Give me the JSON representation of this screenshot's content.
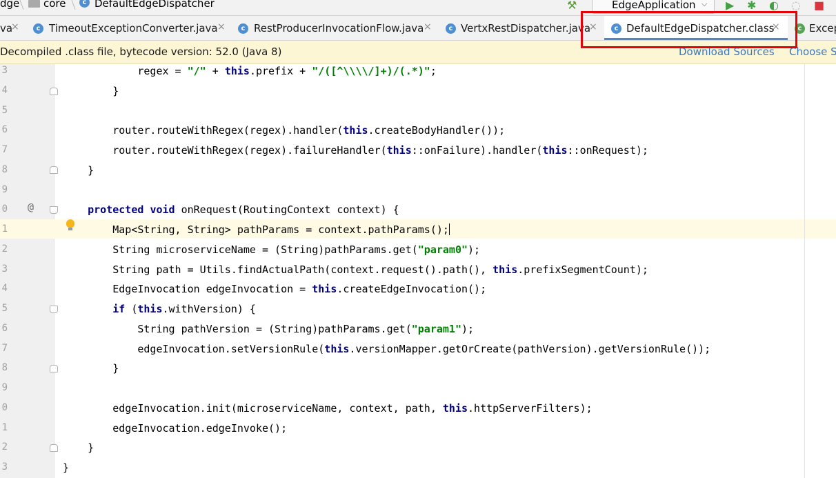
{
  "breadcrumb": {
    "items": [
      "dge",
      "core",
      "DefaultEdgeDispatcher"
    ]
  },
  "toolbar": {
    "run_config": "EdgeApplication"
  },
  "tabs": [
    {
      "label": "va"
    },
    {
      "label": "TimeoutExceptionConverter.java"
    },
    {
      "label": "RestProducerInvocationFlow.java"
    },
    {
      "label": "VertxRestDispatcher.java"
    },
    {
      "label": "DefaultEdgeDispatcher.class",
      "active": true
    },
    {
      "label": "Excep"
    }
  ],
  "tab_close_glyph": "×",
  "banner": {
    "message": "Decompiled .class file, bytecode version: 52.0 (Java 8)",
    "download_sources": "Download Sources",
    "choose_sources": "Choose S"
  },
  "gutter": {
    "line_numbers": [
      "3",
      "4",
      "5",
      "6",
      "7",
      "8",
      "9",
      "0",
      "1",
      "2",
      "3",
      "4",
      "5",
      "6",
      "7",
      "8",
      "9",
      "0",
      "1",
      "2",
      "3"
    ],
    "override_marker": "@"
  },
  "code": [
    "            regex = \"/\" + this.prefix + \"/([^\\\\\\\\/]+)/(.*)\";",
    "        }",
    "",
    "        router.routeWithRegex(regex).handler(this.createBodyHandler());",
    "        router.routeWithRegex(regex).failureHandler(this::onFailure).handler(this::onRequest);",
    "    }",
    "",
    "    protected void onRequest(RoutingContext context) {",
    "        Map<String, String> pathParams = context.pathParams();",
    "        String microserviceName = (String)pathParams.get(\"param0\");",
    "        String path = Utils.findActualPath(context.request().path(), this.prefixSegmentCount);",
    "        EdgeInvocation edgeInvocation = this.createEdgeInvocation();",
    "        if (this.withVersion) {",
    "            String pathVersion = (String)pathParams.get(\"param1\");",
    "            edgeInvocation.setVersionRule(this.versionMapper.getOrCreate(pathVersion).getVersionRule());",
    "        }",
    "",
    "        edgeInvocation.init(microserviceName, context, path, this.httpServerFilters);",
    "        edgeInvocation.edgeInvoke();",
    "    }",
    "}"
  ],
  "colors": {
    "keyword": "#000080",
    "string": "#008000",
    "highlight_box": "#e8000b",
    "current_line": "#fffae3",
    "banner_bg": "#fdf6d4",
    "link": "#3a78c2",
    "active_tab_underline": "#4a88c7"
  },
  "icons": [
    "folder-icon",
    "class-icon",
    "hammer-icon",
    "run-icon",
    "debug-icon",
    "coverage-icon",
    "profile-icon",
    "stop-icon",
    "lightbulb-icon",
    "fold-icon"
  ]
}
